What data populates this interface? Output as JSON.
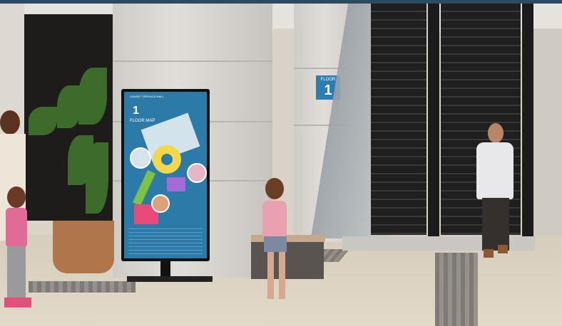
{
  "floor_sign": {
    "label": "FLOOR",
    "number": "1"
  },
  "kiosk": {
    "title": "SUNSET TERRACE MALL",
    "floor_number": "1",
    "floor_label": "FLOOR MAP"
  },
  "colors": {
    "kiosk_screen": "#2b7aa8",
    "floor_sign": "#2c7db1",
    "escalator": "#1b1b1b"
  }
}
